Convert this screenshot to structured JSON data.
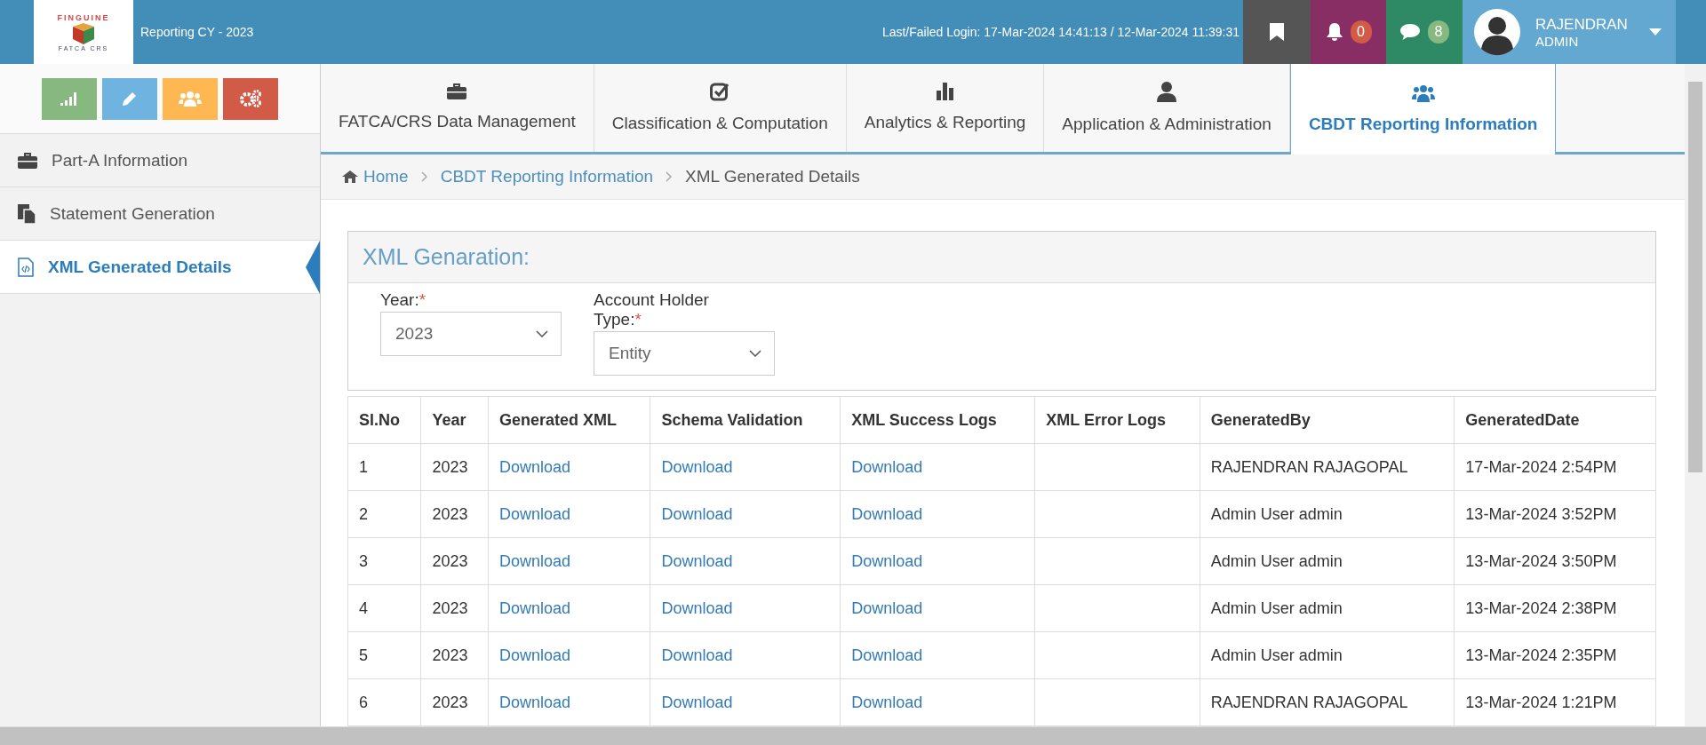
{
  "header": {
    "logo": {
      "name": "FINGUINE",
      "sub": "FATCA CRS"
    },
    "reporting": "Reporting CY - 2023",
    "login": "Last/Failed Login: 17-Mar-2024 14:41:13 / 12-Mar-2024 11:39:31",
    "notifications": "0",
    "messages": "8",
    "user": {
      "name": "RAJENDRAN",
      "role": "ADMIN"
    }
  },
  "shortcuts": [
    {
      "kind": "signal",
      "color": "#87b87f"
    },
    {
      "kind": "pencil",
      "color": "#6fb3e0"
    },
    {
      "kind": "users",
      "color": "#ffb752"
    },
    {
      "kind": "cogs",
      "color": "#d15b47"
    }
  ],
  "sidebar": {
    "items": [
      {
        "label": "Part-A Information",
        "kind": "briefcase",
        "selected": false
      },
      {
        "label": "Statement Generation",
        "kind": "copy",
        "selected": false
      },
      {
        "label": "XML Generated Details",
        "kind": "code",
        "selected": true
      }
    ]
  },
  "tabs": [
    {
      "label": "FATCA/CRS Data Management",
      "kind": "briefcase",
      "selected": false
    },
    {
      "label": "Classification & Computation",
      "kind": "check",
      "selected": false
    },
    {
      "label": "Analytics & Reporting",
      "kind": "chart",
      "selected": false
    },
    {
      "label": "Application & Administration",
      "kind": "user",
      "selected": false
    },
    {
      "label": "CBDT Reporting Information",
      "kind": "users",
      "selected": true
    }
  ],
  "breadcrumb": [
    {
      "label": "Home",
      "kind": "home"
    },
    {
      "label": "CBDT Reporting Information",
      "kind": "link"
    },
    {
      "label": "XML Generated Details",
      "kind": "current"
    }
  ],
  "panel": {
    "title": "XML Genaration:",
    "fields": [
      {
        "label": "Year:",
        "required_mark": "*",
        "value": "2023"
      },
      {
        "label": "Account Holder Type:",
        "required_mark": "*",
        "value": "Entity"
      }
    ]
  },
  "table": {
    "columns": [
      "Sl.No",
      "Year",
      "Generated XML",
      "Schema Validation",
      "XML Success Logs",
      "XML Error Logs",
      "GeneratedBy",
      "GeneratedDate"
    ],
    "rows": [
      {
        "sl_no": "1",
        "year": "2023",
        "generated_xml": "Download",
        "schema_validation": "Download",
        "xml_success_logs": "Download",
        "generated_by": "RAJENDRAN RAJAGOPAL",
        "generated_date": "17-Mar-2024 2:54PM"
      },
      {
        "sl_no": "2",
        "year": "2023",
        "generated_xml": "Download",
        "schema_validation": "Download",
        "xml_success_logs": "Download",
        "generated_by": "Admin User admin",
        "generated_date": "13-Mar-2024 3:52PM"
      },
      {
        "sl_no": "3",
        "year": "2023",
        "generated_xml": "Download",
        "schema_validation": "Download",
        "xml_success_logs": "Download",
        "generated_by": "Admin User admin",
        "generated_date": "13-Mar-2024 3:50PM"
      },
      {
        "sl_no": "4",
        "year": "2023",
        "generated_xml": "Download",
        "schema_validation": "Download",
        "xml_success_logs": "Download",
        "generated_by": "Admin User admin",
        "generated_date": "13-Mar-2024 2:38PM"
      },
      {
        "sl_no": "5",
        "year": "2023",
        "generated_xml": "Download",
        "schema_validation": "Download",
        "xml_success_logs": "Download",
        "generated_by": "Admin User admin",
        "generated_date": "13-Mar-2024 2:35PM"
      },
      {
        "sl_no": "6",
        "year": "2023",
        "generated_xml": "Download",
        "schema_validation": "Download",
        "xml_success_logs": "Download",
        "generated_by": "RAJENDRAN RAJAGOPAL",
        "generated_date": "13-Mar-2024 1:21PM"
      }
    ]
  }
}
